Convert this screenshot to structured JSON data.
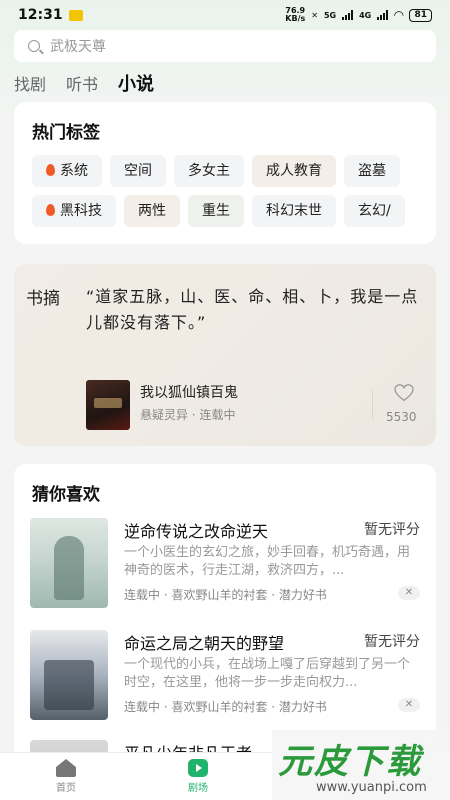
{
  "status": {
    "time": "12:31",
    "net_speed_value": "76.9",
    "net_speed_unit": "KB/s",
    "sig1": "5G",
    "sig2": "4G",
    "battery": "81"
  },
  "search": {
    "placeholder": "武极天尊"
  },
  "tabs": [
    {
      "label": "找剧",
      "active": false
    },
    {
      "label": "听书",
      "active": false
    },
    {
      "label": "小说",
      "active": true
    }
  ],
  "hot_tags": {
    "title": "热门标签",
    "row1": [
      "系统",
      "空间",
      "多女主",
      "成人教育",
      "盗墓"
    ],
    "row2": [
      "黑科技",
      "两性",
      "重生",
      "科幻末世",
      "玄幻/"
    ]
  },
  "excerpt": {
    "label": "书摘",
    "quote": "“道家五脉，山、医、命、相、卜，我是一点儿都没有落下。”",
    "book_title": "我以狐仙镇百鬼",
    "book_meta": "悬疑灵异 · 连载中",
    "likes": "5530",
    "heart_icon": "heart-icon"
  },
  "guess": {
    "title": "猜你喜欢",
    "books": [
      {
        "title": "逆命传说之改命逆天",
        "score": "暂无评分",
        "desc": "一个小医生的玄幻之旅，妙手回春，机巧奇遇，用神奇的医术，行走江湖，救济四方，...",
        "meta": "连载中 · 喜欢野山羊的衬套 · 潜力好书"
      },
      {
        "title": "命运之局之朝天的野望",
        "score": "暂无评分",
        "desc": "一个现代的小兵，在战场上嘎了后穿越到了另一个时空，在这里，他将一步一步走向权力...",
        "meta": "连载中 · 喜欢野山羊的衬套 · 潜力好书"
      },
      {
        "title": "平凡少年非凡王者",
        "score": "",
        "desc": "",
        "meta": ""
      }
    ]
  },
  "nav": {
    "home": "首页",
    "theater": "剧场"
  },
  "watermark": {
    "big": "元皮下载",
    "small": "www.yuanpi.com"
  },
  "colors": {
    "accent": "#21b26b",
    "flame": "#f05a28"
  }
}
